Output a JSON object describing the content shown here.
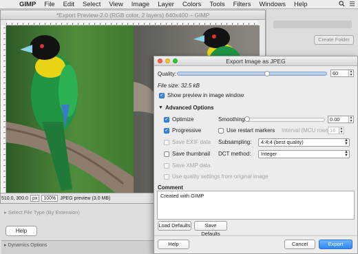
{
  "menubar": {
    "app": "GIMP",
    "items": [
      "File",
      "Edit",
      "Select",
      "View",
      "Image",
      "Layer",
      "Colors",
      "Tools",
      "Filters",
      "Windows",
      "Help"
    ]
  },
  "preview_window": {
    "title": "*Export Preview-2.0 (RGB color, 2 layers) 640x400 – GIMP",
    "coords": "510.0, 300.0",
    "unit": "px",
    "zoom": "100%",
    "status": "JPEG preview (3.0 MB)"
  },
  "background": {
    "create_folder": "Create Folder",
    "file_type": "Select File Type (By Extension)",
    "help": "Help",
    "dynamics": "Dynamics Options"
  },
  "dialog": {
    "title": "Export Image as JPEG",
    "quality_label": "Quality:",
    "quality_value": "60",
    "quality_level": 0.6,
    "file_size": "File size: 32.5 kB",
    "show_preview": "Show preview in image window",
    "advanced": "Advanced Options",
    "optimize": "Optimize",
    "progressive": "Progressive",
    "save_exif": "Save EXIF data",
    "save_thumbnail": "Save thumbnail",
    "save_xmp": "Save XMP data",
    "use_quality": "Use quality settings from original image",
    "smoothing_label": "Smoothing:",
    "smoothing_value": "0.00",
    "restart_markers": "Use restart markers",
    "interval_label": "Interval (MCU rows):",
    "interval_value": "16",
    "subsampling_label": "Subsampling:",
    "subsampling_value": "4:4:4 (best quality)",
    "dct_label": "DCT method:",
    "dct_value": "Integer",
    "comment_label": "Comment",
    "comment_text": "Created with GIMP",
    "load_defaults": "Load Defaults",
    "save_defaults": "Save Defaults",
    "help": "Help",
    "cancel": "Cancel",
    "export": "Export"
  }
}
